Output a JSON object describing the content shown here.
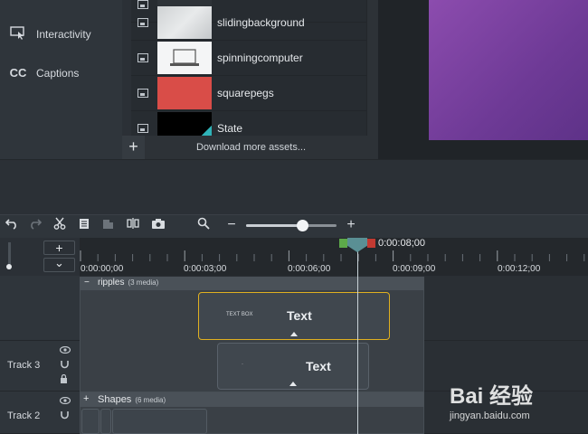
{
  "sidebar": {
    "items": [
      {
        "label": "Interactivity",
        "icon": "interactivity-icon"
      },
      {
        "label": "Captions",
        "icon": "cc-icon",
        "icon_text": "CC"
      }
    ]
  },
  "assets": {
    "items": [
      {
        "name": "slidingbackground"
      },
      {
        "name": "spinningcomputer"
      },
      {
        "name": "squarepegs"
      },
      {
        "name": "State"
      }
    ],
    "add_label": "+",
    "download_label": "Download more assets..."
  },
  "colors": {
    "preview": "#8c4cae",
    "selected_clip_border": "#e0b020",
    "playhead": "#5a8f94"
  },
  "toolbar": {
    "icons": [
      "undo-icon",
      "redo-icon",
      "cut-icon",
      "copy-icon",
      "paste-icon",
      "split-icon",
      "snapshot-icon",
      "zoom-icon"
    ],
    "zoom_minus": "−",
    "zoom_plus": "+",
    "zoom_level": 0.63
  },
  "timeline": {
    "add_track": "+",
    "collapse": "⌄",
    "ticks": [
      "0:00:00;00",
      "0:00:03;00",
      "0:00:06;00",
      "0:00:09;00",
      "0:00:12;00"
    ],
    "playhead_time": "0:00:08;00",
    "tracks": [
      {
        "label": ""
      },
      {
        "label": "Track 3"
      },
      {
        "label": "Track 2"
      }
    ],
    "groups": [
      {
        "toggle": "−",
        "title": "ripples",
        "count": "(3 media)"
      },
      {
        "toggle": "+",
        "title": "Shapes",
        "count": "(6 media)"
      }
    ],
    "clips": [
      {
        "title": "Text",
        "thumb": "TEXT BOX"
      },
      {
        "title": "Text",
        "thumb": "·"
      }
    ]
  },
  "watermark": {
    "brand": "Bai 经验",
    "url": "jingyan.baidu.com"
  }
}
